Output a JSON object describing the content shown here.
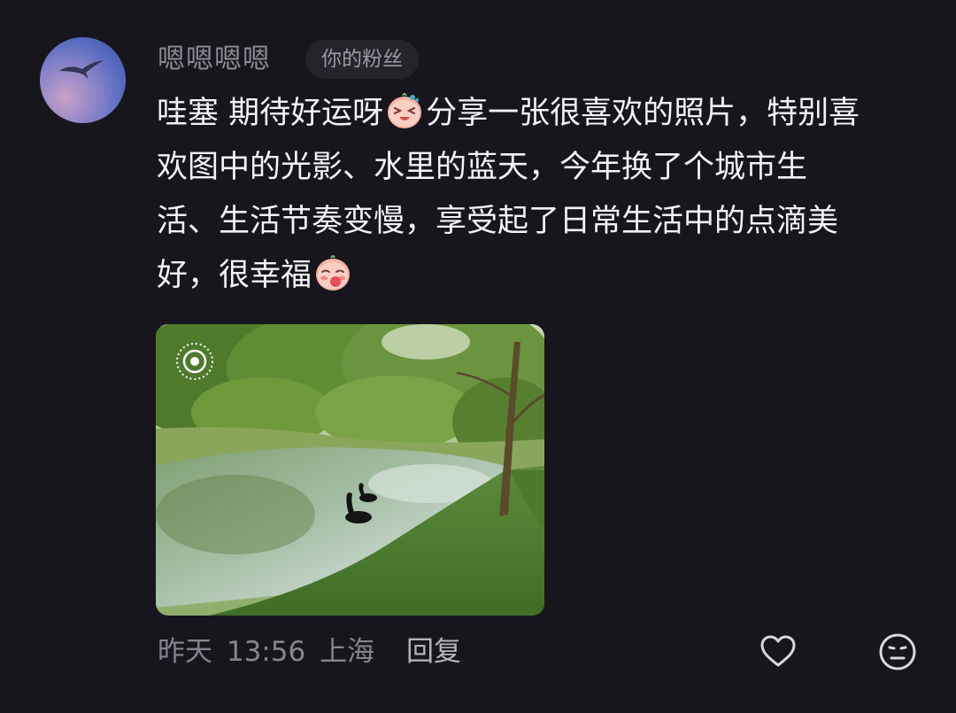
{
  "comment": {
    "username": "嗯嗯嗯嗯",
    "fan_tag": "你的粉丝",
    "text_lines": [
      [
        "哇塞 期待好运呀",
        "分享一张很喜欢的照片，特别喜"
      ],
      "欢图中的光影、水里的蓝天，今年换了个城市生",
      "活、生活节奏变慢，享受起了日常生活中的点滴美",
      [
        "好，很幸福",
        ""
      ]
    ],
    "emojis": [
      "excited-face-emoji",
      "blush-face-emoji"
    ],
    "date": "昨天",
    "time": "13:56",
    "location": "上海",
    "reply_label": "回复"
  },
  "colors": {
    "background": "#17161c",
    "username": "#8d8c93",
    "text": "#f3f3f5",
    "meta": "#86858c",
    "tag_bg": "#25242b"
  },
  "icons": {
    "like": "heart-outline-icon",
    "react": "neutral-face-icon",
    "live_photo": "live-photo-icon"
  }
}
